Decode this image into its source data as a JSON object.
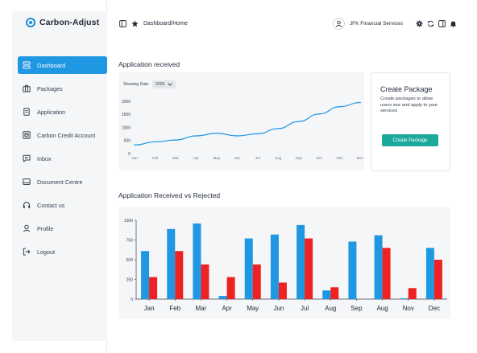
{
  "sidebar": {
    "logo_text": "Carbon-Adjust",
    "items": [
      {
        "label": "Dashboard",
        "icon": "dashboard-icon",
        "active": true
      },
      {
        "label": "Packages",
        "icon": "briefcase-icon"
      },
      {
        "label": "Application",
        "icon": "document-icon"
      },
      {
        "label": "Carbon Credit Account",
        "icon": "wallet-icon"
      },
      {
        "label": "Inbox",
        "icon": "chat-icon"
      },
      {
        "label": "Document Centre",
        "icon": "folder-icon"
      },
      {
        "label": "Contact us",
        "icon": "headset-icon"
      },
      {
        "label": "Profile",
        "icon": "user-icon"
      },
      {
        "label": "Logout",
        "icon": "logout-icon"
      }
    ]
  },
  "header": {
    "breadcrumb": "Dashboard/Home",
    "user_name": "JFK Financial Services",
    "tools": [
      "gear-icon",
      "refresh-icon",
      "panel-icon",
      "bell-icon"
    ]
  },
  "line_section": {
    "title": "Application received",
    "showing_label": "Showing Data",
    "year": "2025"
  },
  "create_package": {
    "title": "Create Package",
    "description": "Create packages to allow users see and apply to your services",
    "button": "Create Package",
    "button_color": "#1ba99c"
  },
  "bar_section": {
    "title": "Application Received vs Rejected"
  },
  "chart_data": [
    {
      "type": "line",
      "x": [
        "Jan",
        "Feb",
        "Mar",
        "Apr",
        "May",
        "Jun",
        "Jul",
        "Aug",
        "Sep",
        "Oct",
        "Nov",
        "Dec"
      ],
      "y": [
        330,
        450,
        520,
        680,
        780,
        680,
        760,
        960,
        1230,
        1520,
        1800,
        1960
      ],
      "yticks": [
        0,
        500,
        1000,
        1500,
        2000
      ],
      "ylim": [
        0,
        2100
      ],
      "color": "#1f97e2",
      "grid": false
    },
    {
      "type": "bar",
      "categories": [
        "Jan",
        "Feb",
        "Mar",
        "Apr",
        "May",
        "Jun",
        "Jul",
        "Aug",
        "Sep",
        "Aug",
        "Nov",
        "Dec"
      ],
      "series": [
        {
          "values": [
            610,
            890,
            960,
            40,
            770,
            820,
            940,
            110,
            730,
            810,
            10,
            650
          ],
          "color": "#1f97e2"
        },
        {
          "values": [
            280,
            610,
            440,
            280,
            440,
            210,
            770,
            150,
            0,
            650,
            140,
            500
          ],
          "color": "#ee2222"
        }
      ],
      "yticks": [
        0,
        250,
        500,
        750,
        1000
      ],
      "ylim": [
        0,
        1000
      ],
      "grid": false
    }
  ]
}
